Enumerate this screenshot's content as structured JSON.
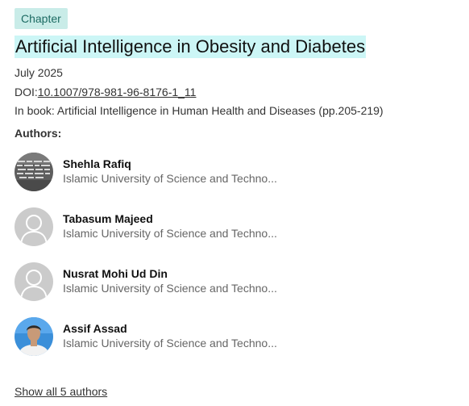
{
  "publication": {
    "type_badge": "Chapter",
    "title": "Artificial Intelligence in Obesity and Diabetes",
    "date": "July 2025",
    "doi_label": "DOI:",
    "doi": "10.1007/978-981-96-8176-1_11",
    "book_citation": "In book: Artificial Intelligence in Human Health and Diseases (pp.205-219)"
  },
  "authors_heading": "Authors:",
  "authors": [
    {
      "name": "Shehla Rafiq",
      "affiliation": "Islamic University of Science and Techno...",
      "avatar": "photo-text"
    },
    {
      "name": "Tabasum Majeed",
      "affiliation": "Islamic University of Science and Techno...",
      "avatar": "placeholder-person-icon"
    },
    {
      "name": "Nusrat Mohi Ud Din",
      "affiliation": "Islamic University of Science and Techno...",
      "avatar": "placeholder-person-icon"
    },
    {
      "name": "Assif Assad",
      "affiliation": "Islamic University of Science and Techno...",
      "avatar": "photo-person"
    }
  ],
  "show_all_label": "Show all 5 authors",
  "colors": {
    "badge_bg": "#c9ece8",
    "badge_text": "#1d6b63",
    "title_highlight": "#ccf6f6",
    "affiliation_text": "#666666",
    "placeholder_avatar": "#cbcbcb"
  }
}
